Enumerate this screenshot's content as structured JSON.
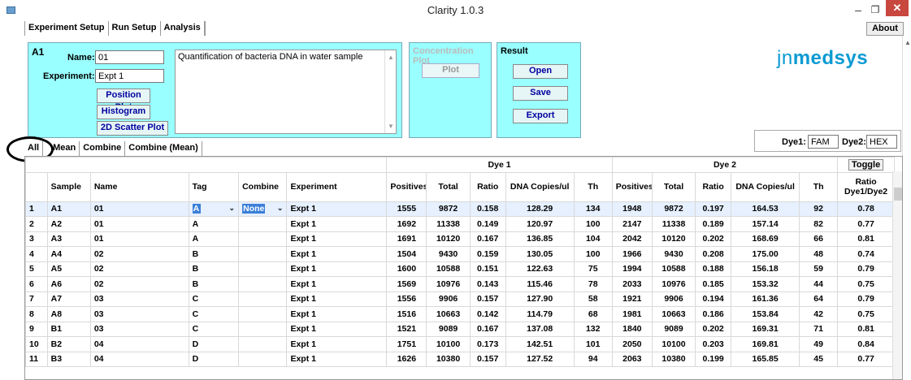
{
  "window": {
    "title": "Clarity 1.0.3",
    "minimize": "‒",
    "maximize": "❐",
    "close": "✕"
  },
  "main_tabs": [
    "Experiment Setup",
    "Run Setup",
    "Analysis"
  ],
  "about_label": "About",
  "well": {
    "id": "A1",
    "name_label": "Name:",
    "name_value": "01",
    "experiment_label": "Experiment:",
    "experiment_value": "Expt 1",
    "description": "Quantification of bacteria DNA in water sample"
  },
  "plot_buttons": [
    "Position Plot",
    "Histogram",
    "2D Scatter Plot"
  ],
  "concentration": {
    "title": "Concentration Plot",
    "plot_label": "Plot"
  },
  "result": {
    "title": "Result",
    "open": "Open",
    "save": "Save",
    "export": "Export"
  },
  "logo": {
    "jn": "jn",
    "medsys": "medsys"
  },
  "dyes": {
    "dye1_label": "Dye1:",
    "dye1_value": "FAM",
    "dye2_label": "Dye2:",
    "dye2_value": "HEX"
  },
  "sub_tabs": [
    "All",
    "Mean",
    "Combine",
    "Combine (Mean)"
  ],
  "table": {
    "group_headers": {
      "dye1": "Dye 1",
      "dye2": "Dye 2",
      "toggle": "Toggle"
    },
    "columns": [
      "Sample",
      "Name",
      "Tag",
      "Combine",
      "Experiment",
      "Positives",
      "Total",
      "Ratio",
      "DNA Copies/ul",
      "Th",
      "Positives",
      "Total",
      "Ratio",
      "DNA Copies/ul",
      "Th",
      "Ratio Dye1/Dye2"
    ],
    "rows": [
      [
        "1",
        "A1",
        "01",
        "A",
        "None",
        "Expt 1",
        "1555",
        "9872",
        "0.158",
        "128.29",
        "134",
        "1948",
        "9872",
        "0.197",
        "164.53",
        "92",
        "0.78"
      ],
      [
        "2",
        "A2",
        "01",
        "A",
        "",
        "Expt 1",
        "1692",
        "11338",
        "0.149",
        "120.97",
        "100",
        "2147",
        "11338",
        "0.189",
        "157.14",
        "82",
        "0.77"
      ],
      [
        "3",
        "A3",
        "01",
        "A",
        "",
        "Expt 1",
        "1691",
        "10120",
        "0.167",
        "136.85",
        "104",
        "2042",
        "10120",
        "0.202",
        "168.69",
        "66",
        "0.81"
      ],
      [
        "4",
        "A4",
        "02",
        "B",
        "",
        "Expt 1",
        "1504",
        "9430",
        "0.159",
        "130.05",
        "100",
        "1966",
        "9430",
        "0.208",
        "175.00",
        "48",
        "0.74"
      ],
      [
        "5",
        "A5",
        "02",
        "B",
        "",
        "Expt 1",
        "1600",
        "10588",
        "0.151",
        "122.63",
        "75",
        "1994",
        "10588",
        "0.188",
        "156.18",
        "59",
        "0.79"
      ],
      [
        "6",
        "A6",
        "02",
        "B",
        "",
        "Expt 1",
        "1569",
        "10976",
        "0.143",
        "115.46",
        "78",
        "2033",
        "10976",
        "0.185",
        "153.32",
        "44",
        "0.75"
      ],
      [
        "7",
        "A7",
        "03",
        "C",
        "",
        "Expt 1",
        "1556",
        "9906",
        "0.157",
        "127.90",
        "58",
        "1921",
        "9906",
        "0.194",
        "161.36",
        "64",
        "0.79"
      ],
      [
        "8",
        "A8",
        "03",
        "C",
        "",
        "Expt 1",
        "1516",
        "10663",
        "0.142",
        "114.79",
        "68",
        "1981",
        "10663",
        "0.186",
        "153.84",
        "42",
        "0.75"
      ],
      [
        "9",
        "B1",
        "03",
        "C",
        "",
        "Expt 1",
        "1521",
        "9089",
        "0.167",
        "137.08",
        "132",
        "1840",
        "9089",
        "0.202",
        "169.31",
        "71",
        "0.81"
      ],
      [
        "10",
        "B2",
        "04",
        "D",
        "",
        "Expt 1",
        "1751",
        "10100",
        "0.173",
        "142.51",
        "101",
        "2050",
        "10100",
        "0.203",
        "169.81",
        "49",
        "0.84"
      ],
      [
        "11",
        "B3",
        "04",
        "D",
        "",
        "Expt 1",
        "1626",
        "10380",
        "0.157",
        "127.52",
        "94",
        "2063",
        "10380",
        "0.199",
        "165.85",
        "45",
        "0.77"
      ]
    ]
  }
}
